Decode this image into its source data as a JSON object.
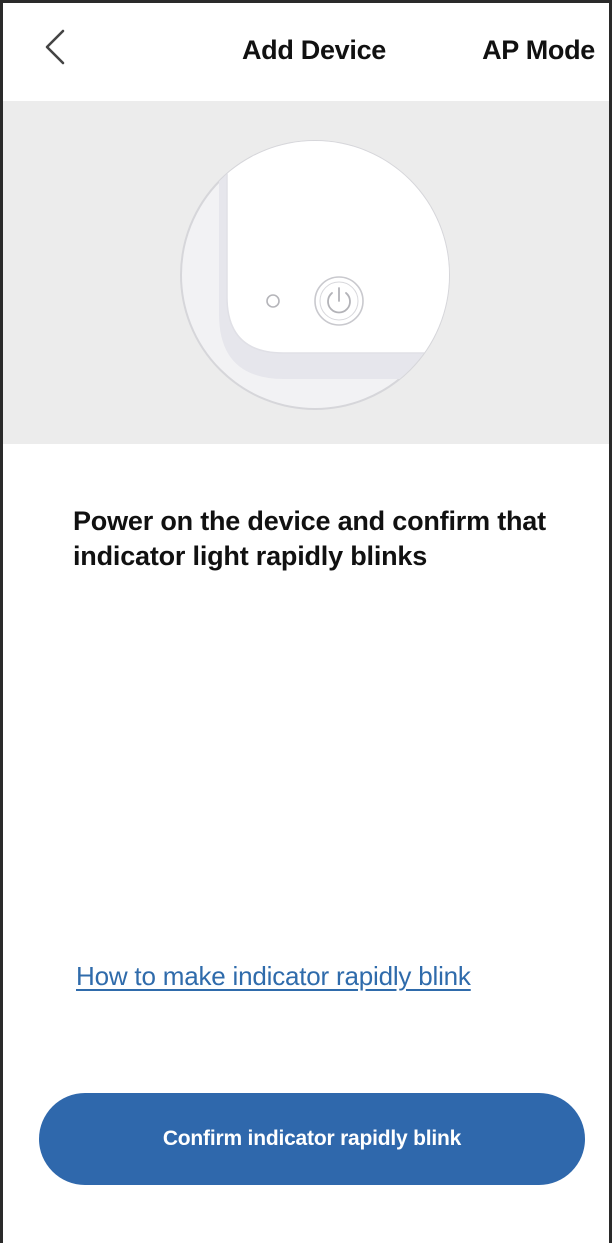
{
  "header": {
    "title": "Add Device",
    "ap_mode_label": "AP Mode",
    "back_icon": "chevron-left-icon"
  },
  "illustration": {
    "device_icon": "device-power-button-icon",
    "colors": {
      "band": "#ececec",
      "circle_fill": "#f2f2f4",
      "circle_stroke": "#d6d6da",
      "device_face": "#ffffff",
      "device_edge": "#e4e4ea"
    }
  },
  "instruction": {
    "text": "Power on the device and confirm that indicator light rapidly blinks"
  },
  "help": {
    "link_text": "How to make indicator rapidly blink"
  },
  "confirm": {
    "label": "Confirm indicator rapidly blink"
  },
  "theme": {
    "accent": "#2f68ac",
    "link": "#2f6bab",
    "text": "#111111"
  }
}
